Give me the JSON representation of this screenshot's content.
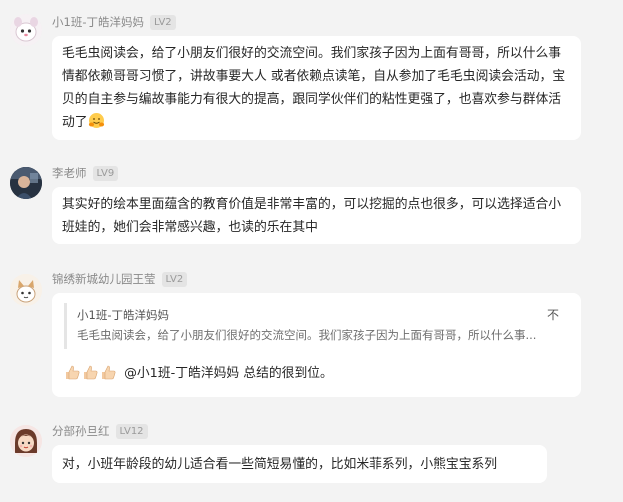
{
  "messages": [
    {
      "author": "小1班-丁皓洋妈妈",
      "level": "LV2",
      "text": "毛毛虫阅读会，给了小朋友们很好的交流空间。我们家孩子因为上面有哥哥，所以什么事情都依赖哥哥习惯了，讲故事要大人 或者依赖点读笔，自从参加了毛毛虫阅读会活动，宝贝的自主参与编故事能力有很大的提高，跟同学伙伴们的粘性更强了，也喜欢参与群体活动了",
      "emoji": "hugging-face-emoji"
    },
    {
      "author": "李老师",
      "level": "LV9",
      "text": "其实好的绘本里面蕴含的教育价值是非常丰富的，可以挖掘的点也很多，可以选择适合小班娃的，她们会非常感兴趣，也读的乐在其中"
    },
    {
      "author": "锦绣新城幼儿园王莹",
      "level": "LV2",
      "quote": {
        "author": "小1班-丁皓洋妈妈",
        "close": "不",
        "text": "毛毛虫阅读会，给了小朋友们很好的交流空间。我们家孩子因为上面有哥哥，所以什么事..."
      },
      "thumbs": [
        "thumbs-up-emoji",
        "thumbs-up-emoji",
        "thumbs-up-emoji"
      ],
      "text": "@小1班-丁皓洋妈妈 总结的很到位。"
    },
    {
      "author": "分部孙旦红",
      "level": "LV12",
      "text": "对，小班年龄段的幼儿适合看一些简短易懂的，比如米菲系列，小熊宝宝系列"
    }
  ]
}
